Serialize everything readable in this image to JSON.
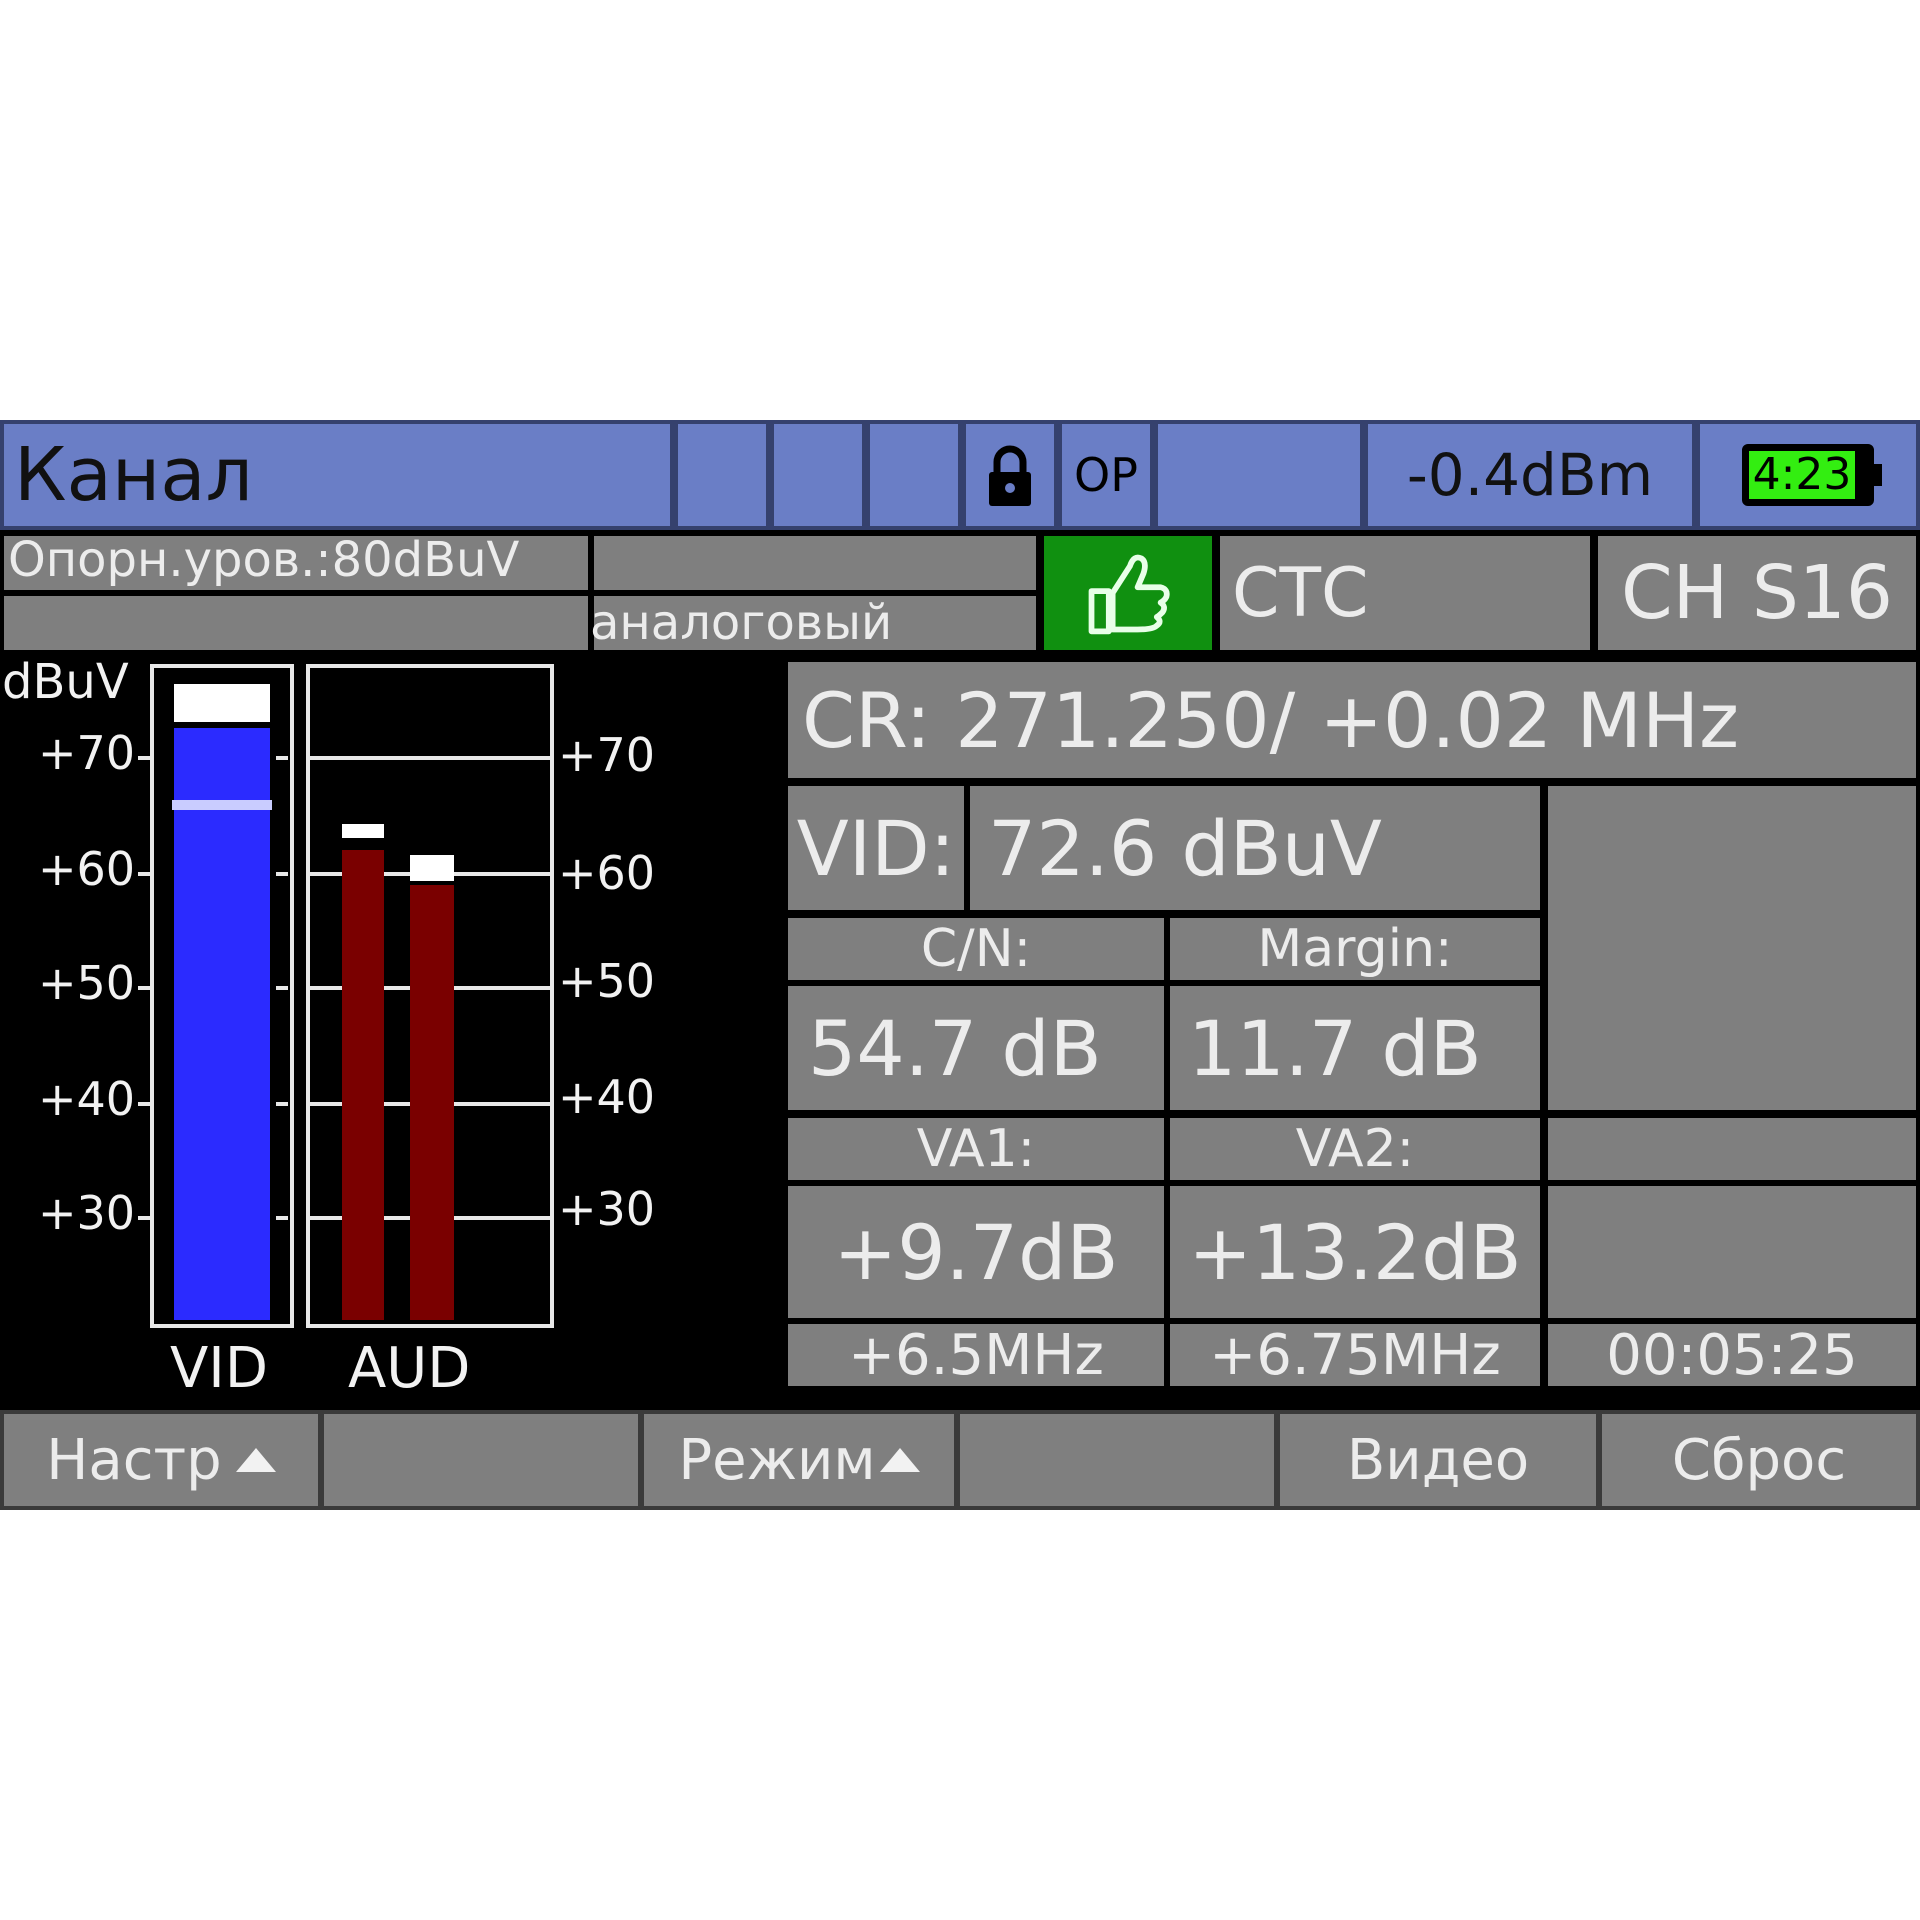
{
  "topbar": {
    "title": "Канал",
    "status_op": "OP",
    "power": "-0.4dBm",
    "battery": "4:23",
    "battery_color": "#33ee11"
  },
  "info": {
    "ref_level": "Опорн.уров.:80dBuV",
    "mode": "аналоговый",
    "channel_name": "СТС",
    "channel_id": "CH S16",
    "ok_color": "#109010"
  },
  "bars": {
    "unit": "dBuV",
    "left_ticks": [
      "+70",
      "+60",
      "+50",
      "+40",
      "+30"
    ],
    "right_ticks": [
      "+70",
      "+60",
      "+50",
      "+40",
      "+30"
    ],
    "vid_label": "VID",
    "aud_label": "AUD",
    "vid_level": 72.6,
    "aud1_level": 62.0,
    "aud2_level": 59.0,
    "vid_color": "#2b2bff",
    "aud_color": "#7a0000"
  },
  "measure": {
    "cr": "CR: 271.250/ +0.02 MHz",
    "vid_label": "VID:",
    "vid_value": "72.6 dBuV",
    "cn_label": "C/N:",
    "cn_value": "54.7 dB",
    "margin_label": "Margin:",
    "margin_value": "11.7 dB",
    "va1_label": "VA1:",
    "va1_value": "+9.7dB",
    "va2_label": "VA2:",
    "va2_value": "+13.2dB",
    "va1_freq": "+6.5MHz",
    "va2_freq": "+6.75MHz",
    "timer": "00:05:25"
  },
  "softkeys": {
    "k1": "Настр",
    "k3": "Режим",
    "k5": "Видео",
    "k6": "Сброс"
  }
}
